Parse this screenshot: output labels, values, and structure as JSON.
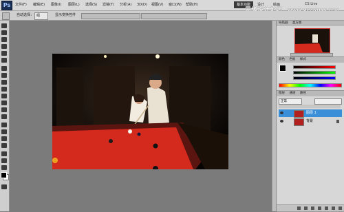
{
  "menubar": {
    "app_icon": "Ps",
    "items": [
      "文件(F)",
      "编辑(E)",
      "图像(I)",
      "图层(L)",
      "选择(S)",
      "滤镜(T)",
      "分析(A)",
      "3D(D)",
      "视图(V)",
      "窗口(W)",
      "帮助(H)"
    ],
    "workspace_active": "基本功能",
    "workspace_2": "设计",
    "workspace_3": "绘画",
    "cs_live": "CS Live"
  },
  "watermark": {
    "main": "思缘设计论坛",
    "url": "WWW.MISSYUAN.COM"
  },
  "options_bar": {
    "style_label": "自动选择：",
    "style_value": "组",
    "show_transform": "显示变换控件"
  },
  "navigator_panel": {
    "tabs": [
      "导航器",
      "直方图"
    ]
  },
  "color_panel": {
    "tabs": [
      "颜色",
      "色板",
      "样式"
    ]
  },
  "layers_panel": {
    "tabs": [
      "图层",
      "通道",
      "路径"
    ],
    "blend_mode": "正常",
    "layers": [
      {
        "name": "图层 1",
        "selected": true
      },
      {
        "name": "背景",
        "selected": false
      }
    ]
  },
  "colors": {
    "table_felt": "#d42a1e",
    "selection": "#3a8fd9"
  }
}
